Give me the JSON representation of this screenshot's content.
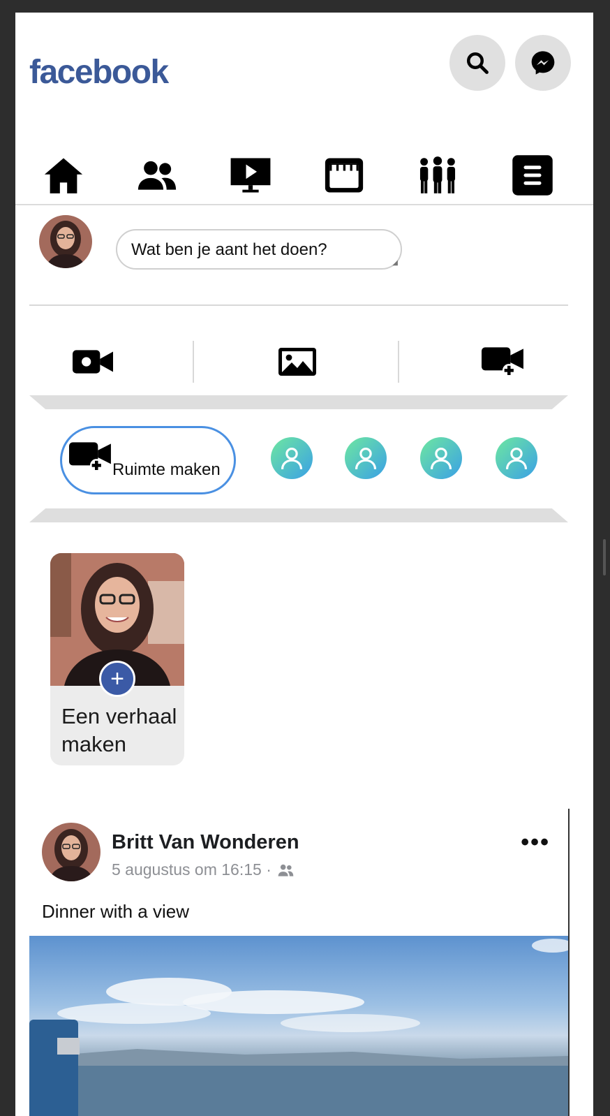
{
  "header": {
    "logo": "facebook",
    "buttons": [
      {
        "name": "search",
        "icon": "search-icon"
      },
      {
        "name": "messenger",
        "icon": "messenger-icon"
      }
    ]
  },
  "nav": {
    "items": [
      {
        "name": "home",
        "icon": "home-icon"
      },
      {
        "name": "friends",
        "icon": "friends-icon"
      },
      {
        "name": "watch",
        "icon": "video-screen-icon"
      },
      {
        "name": "marketplace",
        "icon": "store-icon"
      },
      {
        "name": "groups",
        "icon": "groups-icon"
      },
      {
        "name": "menu",
        "icon": "menu-icon"
      }
    ]
  },
  "composer": {
    "placeholder": "Wat ben je aant het doen?",
    "actions": [
      {
        "name": "live",
        "icon": "video-camera-icon"
      },
      {
        "name": "photo",
        "icon": "image-icon"
      },
      {
        "name": "room",
        "icon": "video-plus-icon"
      }
    ]
  },
  "rooms": {
    "create_label": "Ruimte maken",
    "avatars": 4
  },
  "story": {
    "label": "Een verhaal maken",
    "plus": "+"
  },
  "post": {
    "author": "Britt Van Wonderen",
    "timestamp": "5 augustus om 16:15 ·",
    "audience_icon": "friends-small-icon",
    "more": "•••",
    "text": "Dinner with a view"
  },
  "colors": {
    "brand": "#3b5998",
    "accent_border": "#4a90e2",
    "story_plus": "#3b5aa6"
  }
}
